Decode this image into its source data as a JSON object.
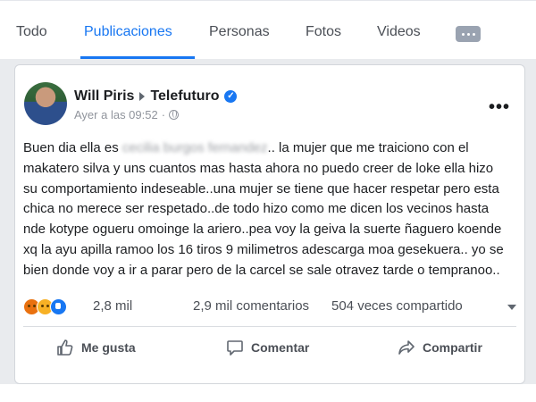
{
  "tabs": [
    "Todo",
    "Publicaciones",
    "Personas",
    "Fotos",
    "Videos"
  ],
  "active_tab": "Publicaciones",
  "post": {
    "author": "Will Piris",
    "page": "Telefuturo",
    "timestamp": "Ayer a las 09:52",
    "text_before": "Buen dia ella es",
    "redacted_name": "cecilia burgos fernandez",
    "text_after": ".. la mujer que me traiciono con el makatero silva y uns cuantos mas hasta ahora no puedo creer de loke ella hizo su comportamiento indeseable..una mujer se tiene que hacer respetar pero esta chica no merece ser respetado..de todo hizo como me dicen los vecinos hasta nde kotype ogueru omoinge la ariero..pea voy la geiva la suerte ñaguero koende xq la ayu apilla ramoo los 16 tiros 9 milimetros adescarga moa gesekuera.. yo se bien donde voy a ir a parar pero de la carcel se sale otravez tarde o tempranoo..",
    "reactions_count": "2,8 mil",
    "comments_count": "2,9 mil comentarios",
    "shares_count": "504 veces compartido",
    "reaction_icons": [
      "angry-icon",
      "wow-icon",
      "like-icon"
    ]
  },
  "actions": {
    "like": "Me gusta",
    "comment": "Comentar",
    "share": "Compartir"
  },
  "colors": {
    "accent": "#1877f2",
    "background": "#e9ebee",
    "text": "#1c1e21",
    "muted": "#90949c"
  }
}
